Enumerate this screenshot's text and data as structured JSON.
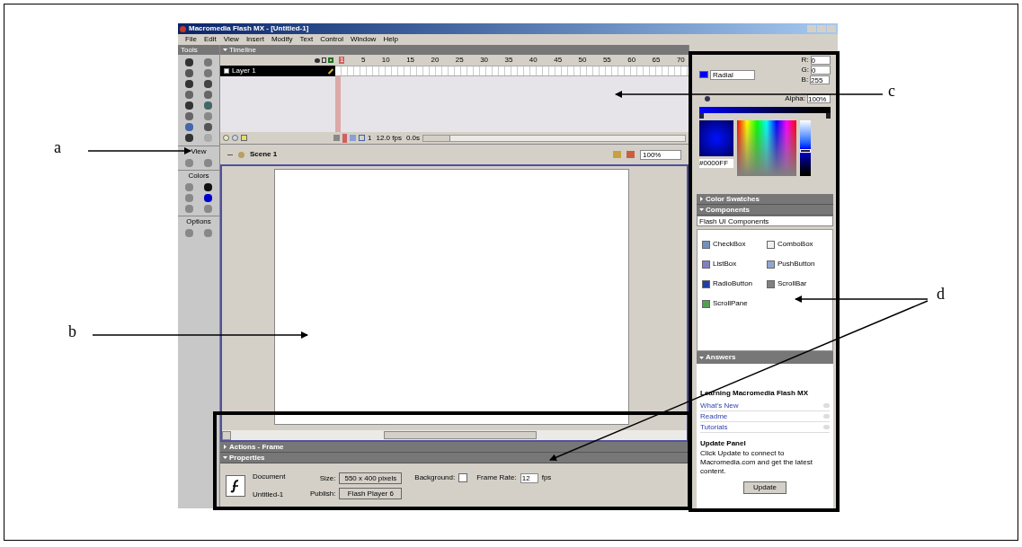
{
  "window": {
    "title": "Macromedia Flash MX - [Untitled-1]"
  },
  "menu": [
    "File",
    "Edit",
    "View",
    "Insert",
    "Modify",
    "Text",
    "Control",
    "Window",
    "Help"
  ],
  "tools_panel": {
    "title": "Tools",
    "sections": [
      "View",
      "Colors",
      "Options"
    ]
  },
  "timeline": {
    "title": "Timeline",
    "expanded": true,
    "frame_numbers": [
      "1",
      "5",
      "10",
      "15",
      "20",
      "25",
      "30",
      "35",
      "40",
      "45",
      "50",
      "55",
      "60",
      "65",
      "70"
    ],
    "layers": [
      {
        "name": "Layer 1",
        "selected": true
      }
    ],
    "status": [
      "1",
      "12.0 fps",
      "0.0s"
    ]
  },
  "scene": {
    "name": "Scene 1",
    "zoom": "100%"
  },
  "color_mixer": {
    "channels": [
      {
        "label": "R:",
        "value": "0"
      },
      {
        "label": "G:",
        "value": "0"
      },
      {
        "label": "B:",
        "value": "255"
      }
    ],
    "fill_type": "Radial",
    "alpha_label": "Alpha:",
    "alpha": "100%",
    "hex": "#0000FF",
    "brightness": {
      "level": 0.45
    }
  },
  "right_panels": [
    {
      "title": "Color Swatches",
      "expanded": false
    },
    {
      "title": "Components",
      "expanded": true
    }
  ],
  "components": {
    "set": "Flash UI Components",
    "items": [
      "CheckBox",
      "ComboBox",
      "ListBox",
      "PushButton",
      "RadioButton",
      "ScrollBar",
      "ScrollPane"
    ]
  },
  "answers": {
    "title": "Answers",
    "expanded": true,
    "heading": "Learning Macromedia Flash MX",
    "links": [
      "What's New",
      "Readme",
      "Tutorials"
    ],
    "update_title": "Update Panel",
    "update_text": "Click Update to connect to Macromedia.com and get the latest content.",
    "update_button": "Update"
  },
  "bottom_panels": [
    {
      "title": "Actions - Frame",
      "expanded": false
    },
    {
      "title": "Properties",
      "expanded": true
    }
  ],
  "properties": {
    "doc_type": "Document",
    "doc_name": "Untitled-1",
    "size_label": "Size:",
    "size": "550 x 400 pixels",
    "publish_label": "Publish:",
    "publish": "Flash Player 6",
    "background_label": "Background:",
    "frame_rate_label": "Frame Rate:",
    "frame_rate": "12",
    "fps": "fps"
  },
  "annotations": [
    "a",
    "b",
    "c",
    "d"
  ]
}
